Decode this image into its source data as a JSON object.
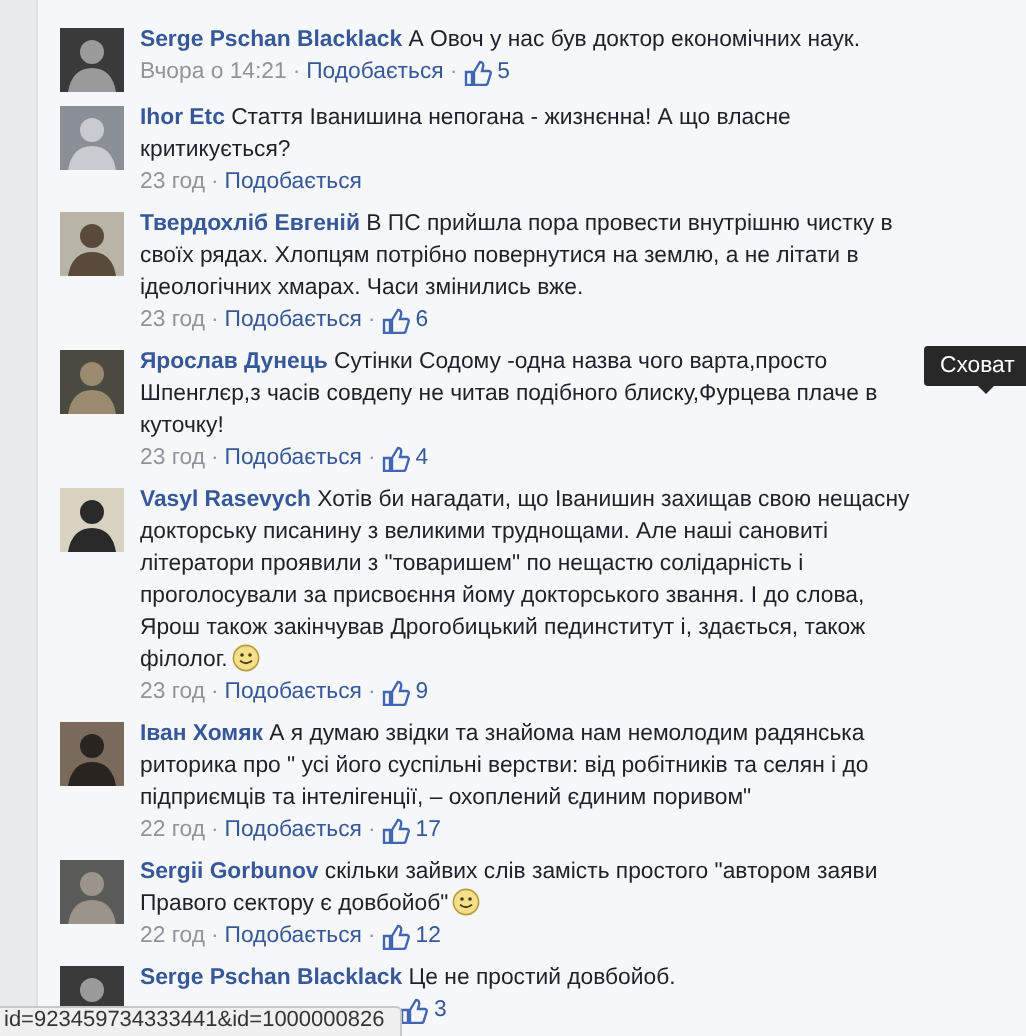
{
  "comments": [
    {
      "author": "Serge Pschan Blacklack",
      "text": "А Овоч у нас був доктор економічних наук.",
      "meta": [
        {
          "kind": "time",
          "text": "Вчора о 14:21"
        },
        {
          "kind": "separator",
          "text": "·"
        },
        {
          "kind": "like_link",
          "text": "Подобається"
        },
        {
          "kind": "separator",
          "text": "·"
        },
        {
          "kind": "likes",
          "text": "5"
        }
      ]
    },
    {
      "author": "Ihor Etc",
      "text": "Стаття Іванишина непогана - жизнєнна! А що власне критикується?",
      "meta": [
        {
          "kind": "time",
          "text": "23 год"
        },
        {
          "kind": "separator",
          "text": "·"
        },
        {
          "kind": "like_link",
          "text": "Подобається"
        }
      ]
    },
    {
      "author": "Твердохліб Евгеній",
      "text": "В ПС прийшла пора провести внутрішню чистку в своїх рядах. Хлопцям потрібно повернутися на землю, а не літати в ідеологічних хмарах. Часи змінились вже.",
      "meta": [
        {
          "kind": "time",
          "text": "23 год"
        },
        {
          "kind": "separator",
          "text": "·"
        },
        {
          "kind": "like_link",
          "text": "Подобається"
        },
        {
          "kind": "separator",
          "text": "·"
        },
        {
          "kind": "likes",
          "text": "6"
        }
      ]
    },
    {
      "author": "Ярослав Дунець",
      "text": "Сутінки Содому -одна назва чого варта,просто Шпенглєр,з часів совдепу не читав подібного блиску,Фурцева плаче в куточку!",
      "tooltip": "Сховат",
      "meta": [
        {
          "kind": "time",
          "text": "23 год"
        },
        {
          "kind": "separator",
          "text": "·"
        },
        {
          "kind": "like_link",
          "text": "Подобається"
        },
        {
          "kind": "separator",
          "text": "·"
        },
        {
          "kind": "likes",
          "text": "4"
        }
      ]
    },
    {
      "author": "Vasyl Rasevych",
      "text": "Хотів би нагадати, що Іванишин захищав свою нещасну докторську писанину з великими труднощами. Але наші сановиті літератори проявили з \"товаришем\" по нещастю солідарність і проголосували за присвоєння йому докторського звання. І до слова, Ярош також закінчував Дрогобицький пединститут і, здається, також філолог.",
      "smiley": true,
      "meta": [
        {
          "kind": "time",
          "text": "23 год"
        },
        {
          "kind": "separator",
          "text": "·"
        },
        {
          "kind": "like_link",
          "text": "Подобається"
        },
        {
          "kind": "separator",
          "text": "·"
        },
        {
          "kind": "likes",
          "text": "9"
        }
      ]
    },
    {
      "author": "Іван Хомяк",
      "text": "А я думаю звідки та знайома нам немолодим радянська риторика про \" усі його суспільні верстви: від робітників та селян і до підприємців та інтелігенції, – охоплений єдиним поривом\"",
      "meta": [
        {
          "kind": "time",
          "text": "22 год"
        },
        {
          "kind": "separator",
          "text": "·"
        },
        {
          "kind": "like_link",
          "text": "Подобається"
        },
        {
          "kind": "separator",
          "text": "·"
        },
        {
          "kind": "likes",
          "text": "17"
        }
      ]
    },
    {
      "author": "Sergii Gorbunov",
      "text": "скільки зайвих слів замість простого \"автором заяви Правого сектору є довбойоб\"",
      "smiley": true,
      "meta": [
        {
          "kind": "time",
          "text": "22 год"
        },
        {
          "kind": "separator",
          "text": "·"
        },
        {
          "kind": "like_link",
          "text": "Подобається"
        },
        {
          "kind": "separator",
          "text": "·"
        },
        {
          "kind": "likes",
          "text": "12"
        }
      ]
    },
    {
      "author": "Serge Pschan Blacklack",
      "text": "Це не простий довбойоб.",
      "meta": [
        {
          "kind": "likes",
          "text": "3"
        }
      ]
    }
  ],
  "status_bar": {
    "text": "id=923459734333441&id=1000000826"
  }
}
